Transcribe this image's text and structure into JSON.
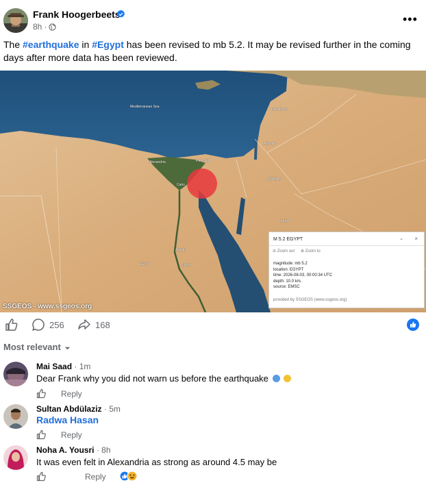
{
  "post": {
    "author": "Frank Hoogerbeets",
    "time": "8h",
    "meta_separator": "·",
    "text_parts": [
      "The ",
      "#earthquake",
      " in ",
      "#Egypt",
      " has been revised to mb 5.2. It may be revised further in the coming days after more data has been reviewed."
    ],
    "more_glyph": "•••"
  },
  "map": {
    "watermark": "SSGEOS - www.ssgeos.org",
    "labels": {
      "sea": "Mediterranean Sea",
      "alexandria": "Alexandria",
      "port_said": "Port Said",
      "cairo": "Cairo",
      "damascus": "Damascus",
      "amman": "Amman",
      "jordan": "JORDAN",
      "egypt": "EGYPT",
      "aswan": "Aswan",
      "luxor": "Luxor",
      "tabuk": "Tabuk"
    },
    "card": {
      "title": "M 5.2 EGYPT",
      "chevron": "⌄",
      "close": "×",
      "zoom_out": "Zoom out",
      "zoom_to": "Zoom to",
      "details": [
        "magnitude: mb 5.2",
        "location: EGYPT",
        "time: 2026-08-03, 00:00:34 UTC",
        "depth: 10.0 km.",
        "source: EMSC"
      ],
      "provider": "provided by SSGEOS (www.ssgeos.org)"
    }
  },
  "actions": {
    "comment_count": "256",
    "share_count": "168"
  },
  "comments_section": {
    "sort_label": "Most relevant"
  },
  "comments": [
    {
      "name": "Mai Saad",
      "time": "1m",
      "text": "Dear Frank why you did not warn us before the earthquake",
      "reply_label": "Reply"
    },
    {
      "name": "Sultan Abdülaziz",
      "time": "5m",
      "mention": "Radwa Hasan",
      "reply_label": "Reply"
    },
    {
      "name": "Noha A. Yousri",
      "time": "8h",
      "text": "It was even felt in Alexandria as strong as around 4.5 may be",
      "reply_label": "Reply"
    }
  ],
  "colors": {
    "link_blue": "#216fdb",
    "secondary_text": "#65676b",
    "quake_circle": "#e8383d"
  }
}
